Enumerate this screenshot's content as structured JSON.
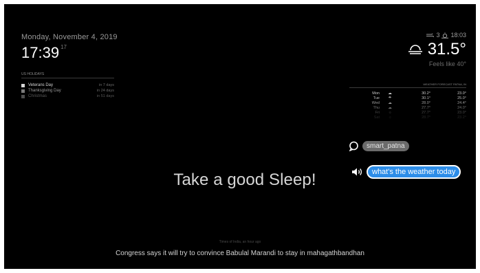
{
  "clock": {
    "date": "Monday, November 4, 2019",
    "time": "17:39",
    "seconds": "17"
  },
  "calendar": {
    "header": "US HOLIDAYS",
    "events": [
      {
        "title": "Veterans Day",
        "when": "in 7 days"
      },
      {
        "title": "Thanksgiving Day",
        "when": "in 24 days"
      },
      {
        "title": "Christmas",
        "when": "in 51 days"
      }
    ]
  },
  "weather": {
    "wind": "3",
    "sunset_time": "18:03",
    "temperature": "31.5°",
    "feels_like": "Feels like 40°",
    "icons": {
      "wind": "wind-icon",
      "sunset": "sunset-icon",
      "current": "haze-icon"
    }
  },
  "forecast": {
    "header": "WEATHER FORECAST PATNA, IN",
    "rows": [
      {
        "day": "Mon",
        "icon": "cloudy-icon",
        "high": "30.2°",
        "low": "23.0°"
      },
      {
        "day": "Tue",
        "icon": "rain-icon",
        "high": "30.1°",
        "low": "25.0°"
      },
      {
        "day": "Wed",
        "icon": "cloudy-icon",
        "high": "28.0°",
        "low": "24.4°"
      },
      {
        "day": "Thu",
        "icon": "cloudy-icon",
        "high": "27.7°",
        "low": "24.0°"
      },
      {
        "day": "Fri",
        "icon": "sun-icon",
        "high": "27.7°",
        "low": "23.0°"
      },
      {
        "day": "Sat",
        "icon": "sun-icon",
        "high": "28.7°",
        "low": "23.2°"
      }
    ]
  },
  "assistant": {
    "user_label": "smart_patna",
    "query": "what's the weather today",
    "icons": {
      "chat": "chat-bubble-icon",
      "speaker": "speaker-icon"
    }
  },
  "message": "Take a good Sleep!",
  "news": {
    "source": "Times of India, an hour ago",
    "headline": "Congress says it will try to convince Babulal Marandi to stay in mahagathbandhan"
  }
}
